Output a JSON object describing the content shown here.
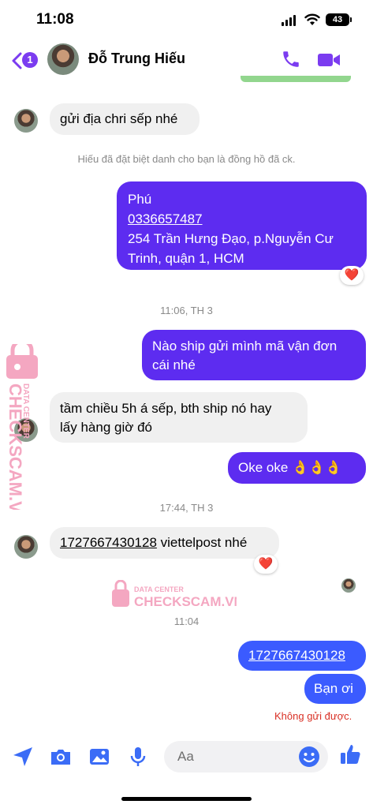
{
  "status_bar": {
    "time": "11:08",
    "battery": "43"
  },
  "header": {
    "unread_count": "1",
    "contact_name": "Đỗ Trung Hiếu",
    "call_icon": "phone-icon",
    "video_icon": "video-camera-icon"
  },
  "messages": {
    "m1": "gửi địa chri sếp nhé",
    "system_note": "Hiếu đã đặt biệt danh cho bạn là đồng hồ đã ck.",
    "address_lines": [
      "Phú",
      "0336657487",
      "254 Trần Hưng Đạo, p.Nguyễn Cư",
      "Trinh, quận 1, HCM"
    ],
    "address_reaction": "❤️",
    "time1": "11:06, TH 3",
    "m2_lines": [
      "Nào ship gửi mình mã vận đơn",
      "cái nhé"
    ],
    "m3_lines": [
      "tầm chiều 5h á sếp, bth ship nó hay",
      "lấy hàng giờ đó"
    ],
    "m4": "Oke oke 👌👌👌",
    "time2": "17:44, TH 3",
    "m5_code": "1727667430128",
    "m5_rest": " viettelpost nhé",
    "m5_reaction": "❤️",
    "time3": "11:04",
    "m6": "1727667430128",
    "m7": "Bạn ơi",
    "error": "Không gửi được."
  },
  "watermark": {
    "brand": "CHECKSCAM.VN",
    "subtitle": "DATA CENTER"
  },
  "composer": {
    "placeholder": "Aa",
    "icons": [
      "location-arrow-icon",
      "camera-icon",
      "gallery-icon",
      "microphone-icon",
      "emoji-icon",
      "thumbs-up-icon"
    ]
  },
  "colors": {
    "accent": "#7b3cf0",
    "bubble_out": "#5d2cf0",
    "bubble_out_blue": "#3b5bff",
    "bubble_in": "#f0f0f0",
    "error": "#d93025",
    "watermark": "#f4a7c1"
  }
}
